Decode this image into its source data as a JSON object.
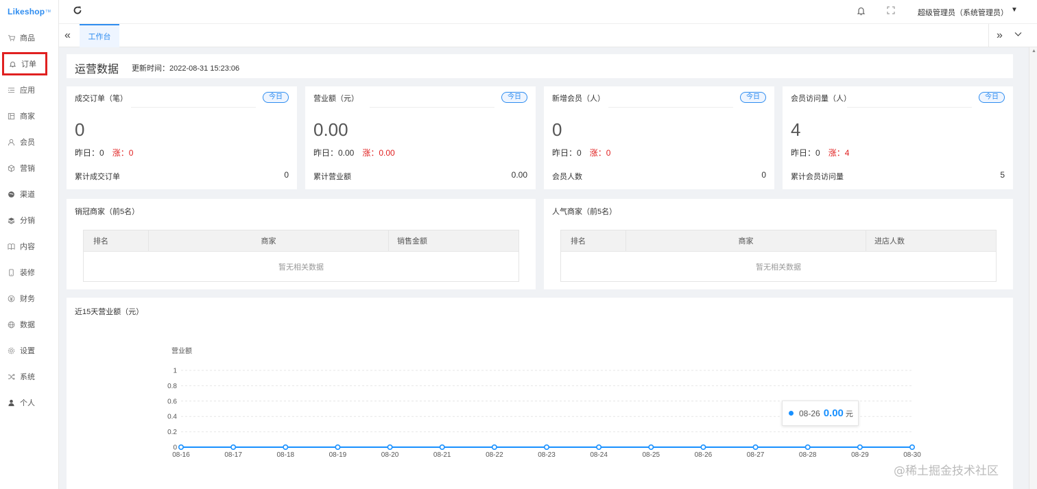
{
  "sidebar": {
    "logo": "Likeshop",
    "logo_tm": "TM",
    "items": [
      {
        "label": "商品",
        "icon": "cart-icon"
      },
      {
        "label": "订单",
        "icon": "bell-icon"
      },
      {
        "label": "应用",
        "icon": "list-icon"
      },
      {
        "label": "商家",
        "icon": "store-icon"
      },
      {
        "label": "会员",
        "icon": "user-icon"
      },
      {
        "label": "营销",
        "icon": "cube-icon"
      },
      {
        "label": "渠道",
        "icon": "globe-icon"
      },
      {
        "label": "分销",
        "icon": "layers-icon"
      },
      {
        "label": "内容",
        "icon": "book-icon"
      },
      {
        "label": "装修",
        "icon": "mobile-icon"
      },
      {
        "label": "财务",
        "icon": "money-icon"
      },
      {
        "label": "数据",
        "icon": "world-icon"
      },
      {
        "label": "设置",
        "icon": "gear-icon"
      },
      {
        "label": "系统",
        "icon": "shuffle-icon"
      },
      {
        "label": "个人",
        "icon": "person-icon"
      }
    ]
  },
  "topbar": {
    "user": "超级管理员（系统管理员）"
  },
  "tabs": {
    "active": "工作台"
  },
  "header": {
    "title": "运营数据",
    "update_label": "更新时间：2022-08-31 15:23:06"
  },
  "stats": [
    {
      "title": "成交订单（笔）",
      "badge": "今日",
      "value": "0",
      "yesterday": "昨日：0",
      "up": "涨：0",
      "total_label": "累计成交订单",
      "total_value": "0"
    },
    {
      "title": "营业额（元）",
      "badge": "今日",
      "value": "0.00",
      "yesterday": "昨日：0.00",
      "up": "涨：0.00",
      "total_label": "累计营业额",
      "total_value": "0.00"
    },
    {
      "title": "新增会员（人）",
      "badge": "今日",
      "value": "0",
      "yesterday": "昨日：0",
      "up": "涨：0",
      "total_label": "会员人数",
      "total_value": "0"
    },
    {
      "title": "会员访问量（人）",
      "badge": "今日",
      "value": "4",
      "yesterday": "昨日：0",
      "up": "涨：4",
      "total_label": "累计会员访问量",
      "total_value": "5"
    }
  ],
  "tables": [
    {
      "title": "销冠商家（前5名）",
      "columns": [
        "排名",
        "商家",
        "销售金额"
      ],
      "empty": "暂无相关数据"
    },
    {
      "title": "人气商家（前5名）",
      "columns": [
        "排名",
        "商家",
        "进店人数"
      ],
      "empty": "暂无相关数据"
    }
  ],
  "chart": {
    "title": "近15天营业额（元）"
  },
  "chart_data": {
    "type": "line",
    "ylabel": "营业额",
    "x": [
      "08-16",
      "08-17",
      "08-18",
      "08-19",
      "08-20",
      "08-21",
      "08-22",
      "08-23",
      "08-24",
      "08-25",
      "08-26",
      "08-27",
      "08-28",
      "08-29",
      "08-30"
    ],
    "yticks": [
      "0",
      "0.2",
      "0.4",
      "0.6",
      "0.8",
      "1"
    ],
    "series": [
      {
        "values": [
          0,
          0,
          0,
          0,
          0,
          0,
          0,
          0,
          0,
          0,
          0,
          0,
          0,
          0,
          0
        ]
      }
    ],
    "ylim": [
      0,
      1
    ],
    "grid": true,
    "color": "#1890ff",
    "tooltip": {
      "date": "08-26",
      "value": "0.00",
      "unit": "元"
    }
  },
  "watermark": "@稀土掘金技术社区"
}
